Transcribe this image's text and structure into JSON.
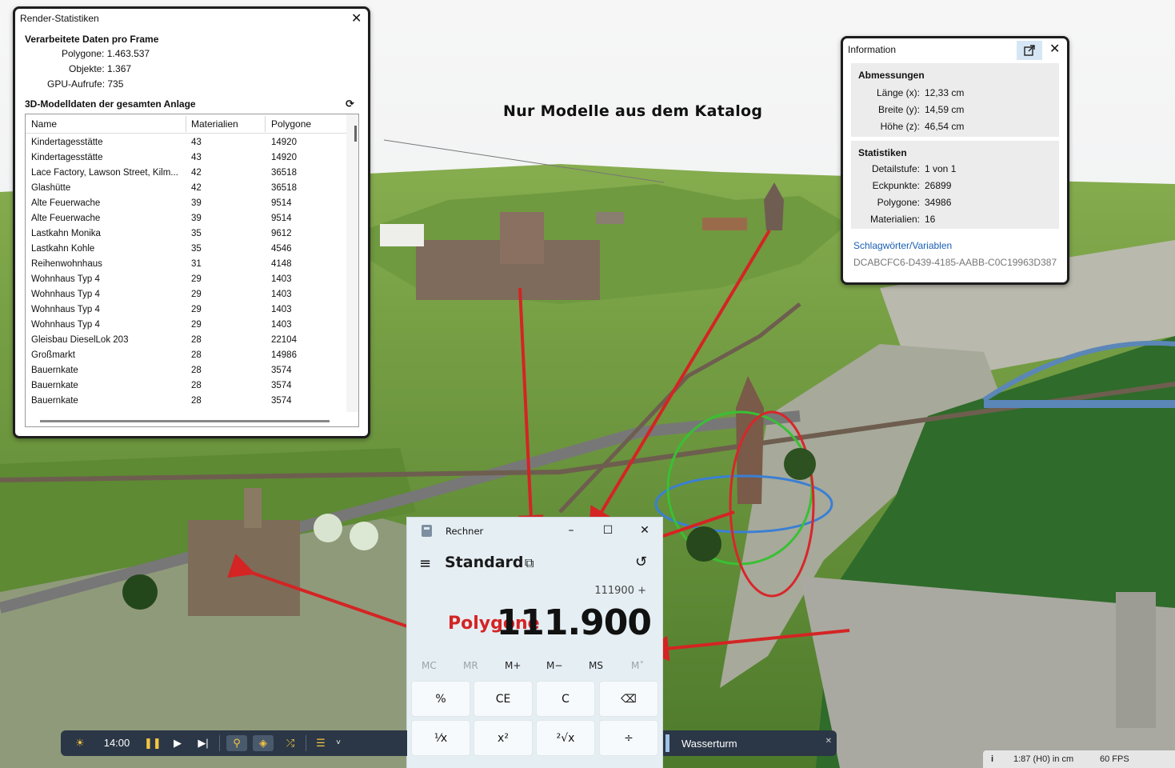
{
  "scene": {
    "title": "Nur Modelle aus dem Katalog",
    "colors": {
      "terrain_dark": "#4f7a2c",
      "terrain_light": "#7aa34a",
      "water": "#2f6b2a",
      "rock": "#9a9a8c",
      "arrow": "#d42424"
    }
  },
  "render_stats": {
    "title": "Render-Statistiken",
    "per_frame_heading": "Verarbeitete Daten pro Frame",
    "stats": [
      {
        "key": "Polygone:",
        "value": "1.463.537"
      },
      {
        "key": "Objekte:",
        "value": "1.367"
      },
      {
        "key": "GPU-Aufrufe:",
        "value": "735"
      }
    ],
    "model_heading": "3D-Modelldaten der gesamten Anlage",
    "refresh_icon": "refresh-icon",
    "columns": [
      "Name",
      "Materialien",
      "Polygone"
    ],
    "rows": [
      {
        "name": "Kindertagesstätte",
        "materials": "43",
        "polygons": "14920"
      },
      {
        "name": "Kindertagesstätte",
        "materials": "43",
        "polygons": "14920"
      },
      {
        "name": " Lace Factory, Lawson Street, Kilm...",
        "materials": "42",
        "polygons": "36518"
      },
      {
        "name": "Glashütte",
        "materials": "42",
        "polygons": "36518"
      },
      {
        "name": "Alte Feuerwache",
        "materials": "39",
        "polygons": "9514"
      },
      {
        "name": "Alte Feuerwache",
        "materials": "39",
        "polygons": "9514"
      },
      {
        "name": "Lastkahn Monika",
        "materials": "35",
        "polygons": "9612"
      },
      {
        "name": "Lastkahn Kohle",
        "materials": "35",
        "polygons": "4546"
      },
      {
        "name": "Reihenwohnhaus",
        "materials": "31",
        "polygons": "4148"
      },
      {
        "name": "Wohnhaus Typ 4",
        "materials": "29",
        "polygons": "1403"
      },
      {
        "name": "Wohnhaus Typ 4",
        "materials": "29",
        "polygons": "1403"
      },
      {
        "name": "Wohnhaus Typ 4",
        "materials": "29",
        "polygons": "1403"
      },
      {
        "name": "Wohnhaus Typ 4",
        "materials": "29",
        "polygons": "1403"
      },
      {
        "name": "Gleisbau DieselLok 203",
        "materials": "28",
        "polygons": "22104"
      },
      {
        "name": "Großmarkt",
        "materials": "28",
        "polygons": "14986"
      },
      {
        "name": "Bauernkate",
        "materials": "28",
        "polygons": "3574"
      },
      {
        "name": "Bauernkate",
        "materials": "28",
        "polygons": "3574"
      },
      {
        "name": "Bauernkate",
        "materials": "28",
        "polygons": "3574"
      }
    ]
  },
  "info": {
    "title": "Information",
    "dimensions_heading": "Abmessungen",
    "dimensions": [
      {
        "key": "Länge (x):",
        "value": "12,33 cm"
      },
      {
        "key": "Breite (y):",
        "value": "14,59 cm"
      },
      {
        "key": "Höhe (z):",
        "value": "46,54 cm"
      }
    ],
    "statistics_heading": "Statistiken",
    "statistics": [
      {
        "key": "Detailstufe:",
        "value": "1 von 1"
      },
      {
        "key": "Eckpunkte:",
        "value": "26899"
      },
      {
        "key": "Polygone:",
        "value": "34986"
      },
      {
        "key": "Materialien:",
        "value": "16"
      }
    ],
    "link": "Schlagwörter/Variablen",
    "guid": "DCABCFC6-D439-4185-AABB-C0C19963D387"
  },
  "calculator": {
    "app_title": "Rechner",
    "mode": "Standard",
    "expression": "111900 +",
    "overlay_label": "Polygone",
    "display": "111.900",
    "memory": [
      {
        "label": "MC",
        "enabled": false
      },
      {
        "label": "MR",
        "enabled": false
      },
      {
        "label": "M+",
        "enabled": true
      },
      {
        "label": "M−",
        "enabled": true
      },
      {
        "label": "MS",
        "enabled": true
      },
      {
        "label": "M˅",
        "enabled": false
      }
    ],
    "keys_row1": [
      "%",
      "CE",
      "C",
      "⌫"
    ],
    "keys_row2": [
      "¹⁄x",
      "x²",
      "²√x",
      "÷"
    ]
  },
  "toolbar": {
    "time": "14:00",
    "selected_object": "Wasserturm"
  },
  "status": {
    "info_icon": "i",
    "scale": "1:87 (H0) in cm",
    "fps": "60 FPS"
  }
}
